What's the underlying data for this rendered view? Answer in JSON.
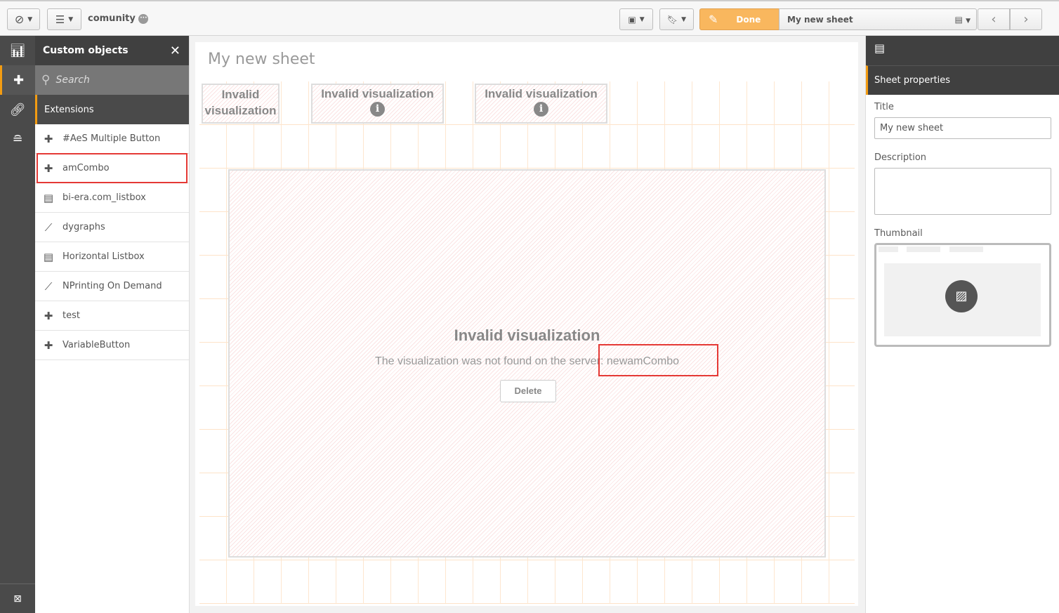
{
  "topbar": {
    "app_name": "comunity",
    "done_label": "Done",
    "sheet_selector": "My new sheet",
    "icons": [
      "compass-icon",
      "list-icon",
      "present-icon",
      "bookmark-icon",
      "pencil-icon",
      "sheet-icon",
      "chevron-left-icon",
      "chevron-right-icon"
    ]
  },
  "panel": {
    "title": "Custom objects",
    "search_placeholder": "Search",
    "category": "Extensions",
    "items": [
      {
        "label": "#AeS Multiple Button",
        "icon": "puzzle-icon"
      },
      {
        "label": "amCombo",
        "icon": "puzzle-icon",
        "highlighted": true
      },
      {
        "label": "bi-era.com_listbox",
        "icon": "listbox-icon"
      },
      {
        "label": "dygraphs",
        "icon": "line-chart-icon"
      },
      {
        "label": "Horizontal Listbox",
        "icon": "listbox-icon"
      },
      {
        "label": "NPrinting On Demand",
        "icon": "line-chart-icon"
      },
      {
        "label": "test",
        "icon": "puzzle-icon"
      },
      {
        "label": "VariableButton",
        "icon": "puzzle-icon"
      }
    ]
  },
  "sheet": {
    "title": "My new sheet",
    "small_viz": [
      {
        "title": "Invalid visualization"
      },
      {
        "title": "Invalid visualization"
      },
      {
        "title": "Invalid visualization"
      }
    ],
    "big_viz": {
      "title": "Invalid visualization",
      "message": "The visualization was not found on the server: newamCombo",
      "delete_label": "Delete"
    }
  },
  "properties": {
    "header": "Sheet properties",
    "title_label": "Title",
    "title_value": "My new sheet",
    "description_label": "Description",
    "description_value": "",
    "thumbnail_label": "Thumbnail"
  },
  "colors": {
    "accent": "#f39c12",
    "done": "#f9b75e",
    "highlight": "#e53935"
  }
}
